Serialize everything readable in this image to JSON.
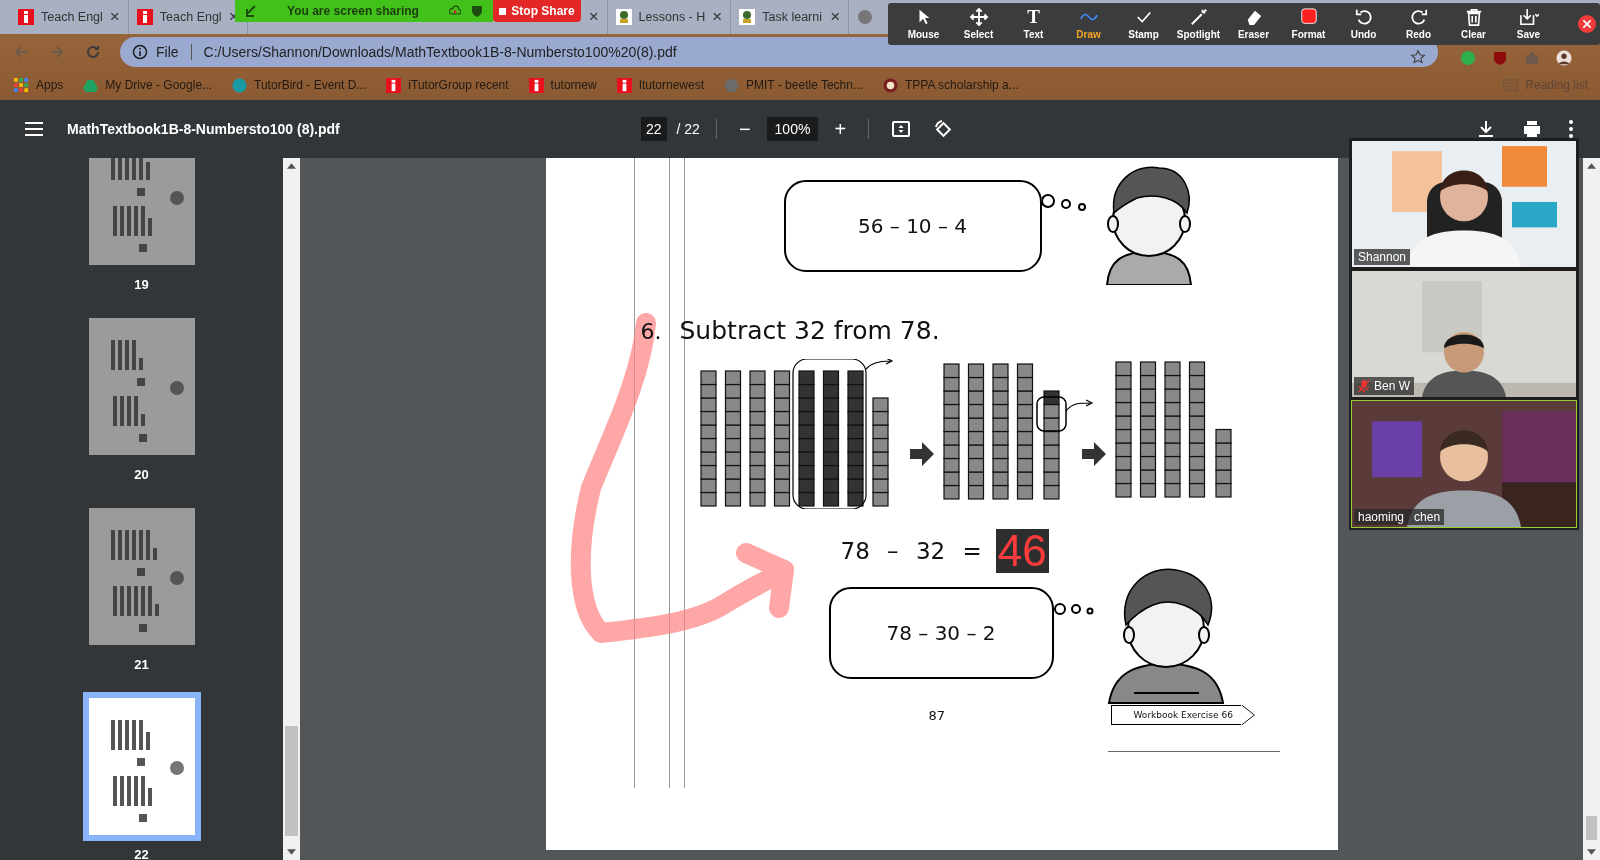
{
  "browser": {
    "tabs": [
      {
        "title": "Teach Engl",
        "close": "×"
      },
      {
        "title": "Teach Engl",
        "close": "×"
      },
      {
        "close": "×"
      },
      {
        "title": "Lessons - H",
        "close": "×"
      },
      {
        "title": "Task learni",
        "close": "×"
      }
    ],
    "address": {
      "scheme": "File",
      "url": "C:/Users/Shannon/Downloads/MathTextbook1B-8-Numbersto100%20(8).pdf"
    },
    "bookmarks": [
      {
        "label": "Apps"
      },
      {
        "label": "My Drive - Google..."
      },
      {
        "label": "TutorBird - Event D..."
      },
      {
        "label": "iTutorGroup recent"
      },
      {
        "label": "tutornew"
      },
      {
        "label": "Itutornewest"
      },
      {
        "label": "PMIT - beetle Techn..."
      },
      {
        "label": "TPPA scholarship a..."
      }
    ],
    "reading_list": "Reading list"
  },
  "share_banner": {
    "text": "You are screen sharing",
    "stop": "Stop Share"
  },
  "annotation_toolbar": {
    "tools": [
      {
        "label": "Mouse",
        "selected": false
      },
      {
        "label": "Select",
        "selected": false
      },
      {
        "label": "Text",
        "glyph": "T",
        "selected": false
      },
      {
        "label": "Draw",
        "selected": true
      },
      {
        "label": "Stamp",
        "selected": false
      },
      {
        "label": "Spotlight",
        "selected": false
      },
      {
        "label": "Eraser",
        "selected": false
      },
      {
        "label": "Format",
        "selected": false
      },
      {
        "label": "Undo",
        "selected": false
      },
      {
        "label": "Redo",
        "selected": false
      },
      {
        "label": "Clear",
        "selected": false
      },
      {
        "label": "Save",
        "selected": false
      }
    ]
  },
  "pdf_viewer": {
    "title": "MathTextbook1B-8-Numbersto100 (8).pdf",
    "page": "22",
    "total": "/ 22",
    "zoom_out": "−",
    "zoom": "100%",
    "zoom_in": "+",
    "thumbnails": [
      {
        "label": "19",
        "selected": false
      },
      {
        "label": "20",
        "selected": false
      },
      {
        "label": "21",
        "selected": false
      },
      {
        "label": "22",
        "selected": true
      }
    ],
    "page_content": {
      "bubble_top": "56 – 10 – 4",
      "number": "6.",
      "title": "Subtract 32 from 78.",
      "equation": "78 – 32 =",
      "answer": "46",
      "bubble_bottom": "78 – 30 – 2",
      "page_number": "87",
      "workbook": "Workbook Exercise 66"
    }
  },
  "participants": [
    {
      "name": "Shannon",
      "muted": false,
      "active": false
    },
    {
      "name": "Ben W",
      "muted": true,
      "active": false
    },
    {
      "name": "haoming   chen",
      "muted": false,
      "active": true
    }
  ]
}
